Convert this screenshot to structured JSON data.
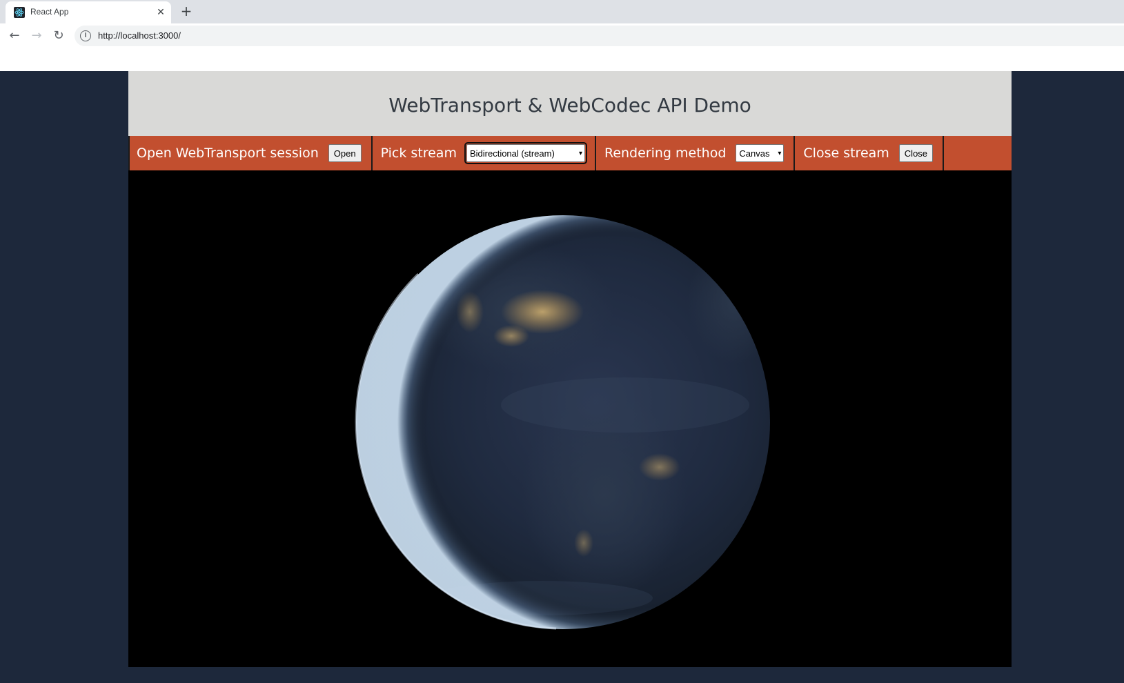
{
  "browser": {
    "tab_title": "React App",
    "url": "http://localhost:3000/",
    "icons": {
      "favicon": "react-icon",
      "close": "close-icon",
      "new_tab": "plus-icon",
      "back": "back-arrow-icon",
      "forward": "forward-arrow-icon",
      "reload": "reload-icon",
      "site_info": "info-icon"
    }
  },
  "app": {
    "title": "WebTransport & WebCodec API Demo",
    "controls": {
      "open_session_label": "Open WebTransport session",
      "open_button": "Open",
      "pick_stream_label": "Pick stream",
      "stream_selected": "Bidirectional (stream)",
      "rendering_label": "Rendering method",
      "rendering_selected": "Canvas",
      "close_stream_label": "Close stream",
      "close_button": "Close"
    },
    "colors": {
      "page_background": "#1d283b",
      "header_background": "#d9d9d7",
      "controls_background": "#c24f2f",
      "video_background": "#000000"
    }
  }
}
